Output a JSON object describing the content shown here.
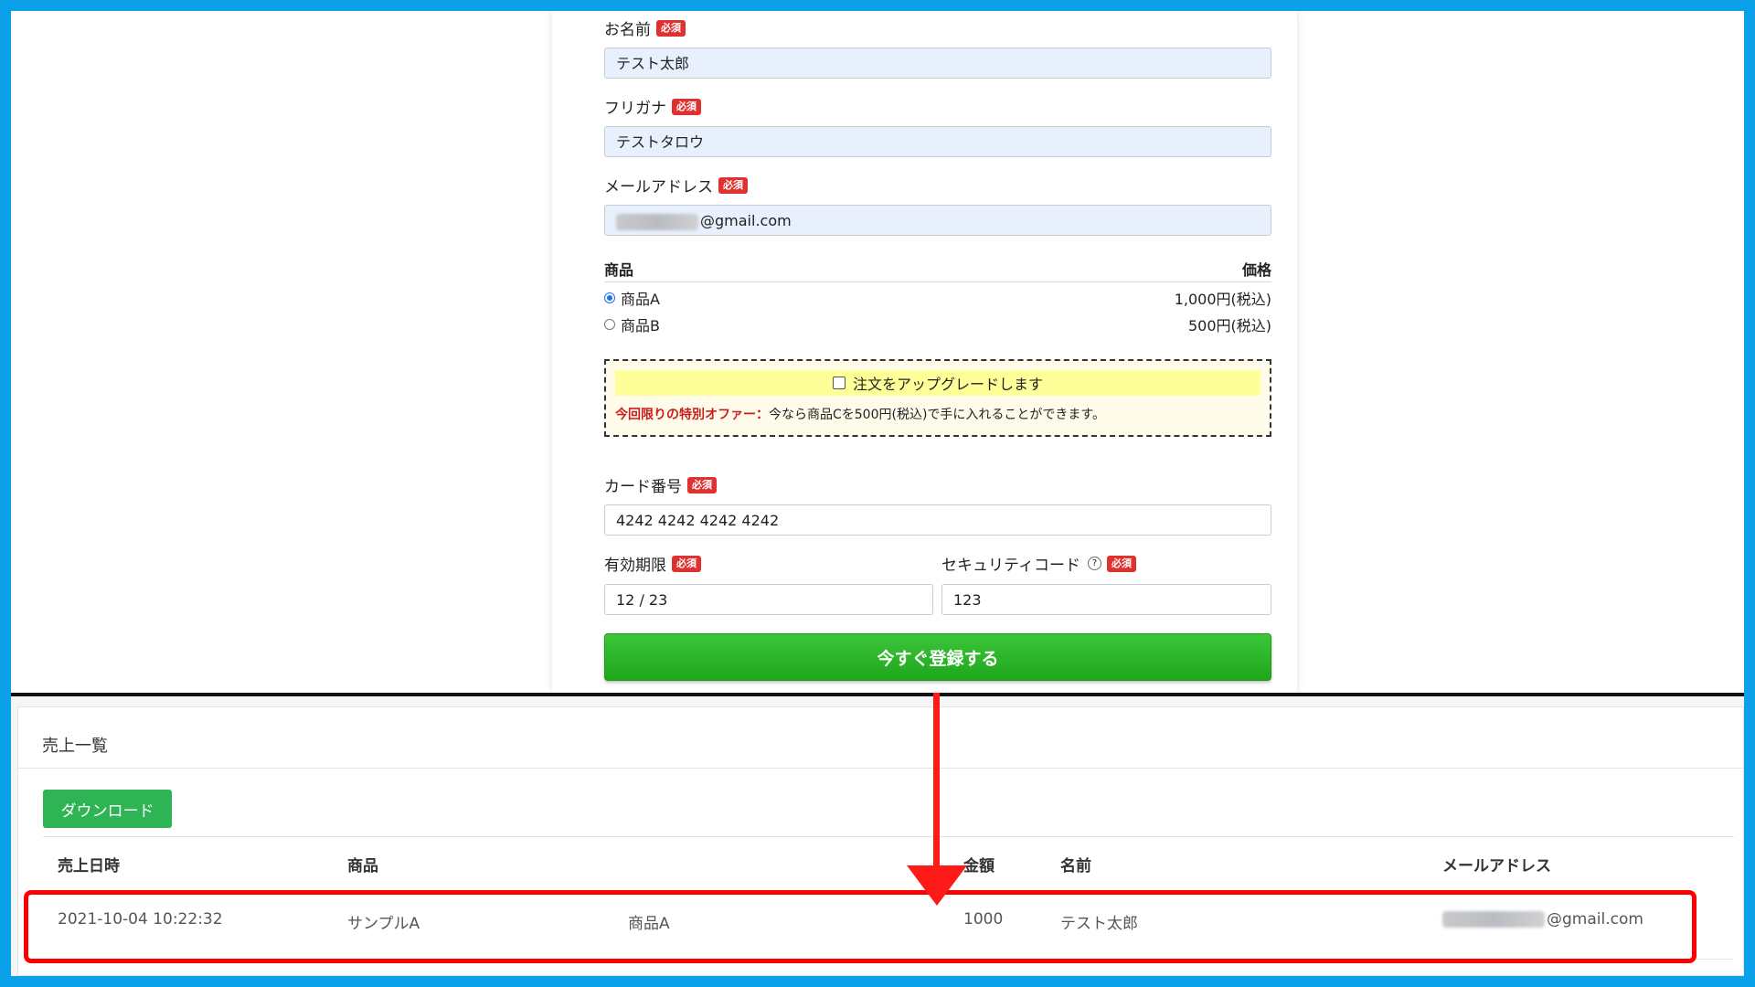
{
  "form": {
    "required_badge": "必須",
    "name_label": "お名前",
    "name_value": "テスト太郎",
    "furigana_label": "フリガナ",
    "furigana_value": "テストタロウ",
    "email_label": "メールアドレス",
    "email_value_suffix": "@gmail.com",
    "product_header": "商品",
    "price_header": "価格",
    "products": [
      {
        "name": "商品A",
        "price": "1,000円(税込)",
        "selected": true
      },
      {
        "name": "商品B",
        "price": "500円(税込)",
        "selected": false
      }
    ],
    "upgrade_label": "注文をアップグレードします",
    "offer_highlight": "今回限りの特別オファー：",
    "offer_text": "今なら商品Cを500円(税込)で手に入れることができます。",
    "card_label": "カード番号",
    "card_value": "4242 4242 4242 4242",
    "expiry_label": "有効期限",
    "expiry_value": "12 / 23",
    "cvc_label": "セキュリティコード",
    "cvc_help": "?",
    "cvc_value": "123",
    "submit_label": "今すぐ登録する"
  },
  "admin": {
    "title": "売上一覧",
    "download_label": "ダウンロード",
    "columns": {
      "date": "売上日時",
      "product": "商品",
      "amount": "金額",
      "name": "名前",
      "email": "メールアドレス"
    },
    "row": {
      "date": "2021-10-04 10:22:32",
      "product": "サンプルA",
      "variant": "商品A",
      "amount": "1000",
      "name": "テスト太郎",
      "email_suffix": "@gmail.com"
    }
  },
  "colors": {
    "accent_frame": "#0aa0ea",
    "required_badge": "#e03131",
    "submit_button": "#22a81f",
    "download_button": "#2fb455",
    "highlight": "#ff0000"
  }
}
